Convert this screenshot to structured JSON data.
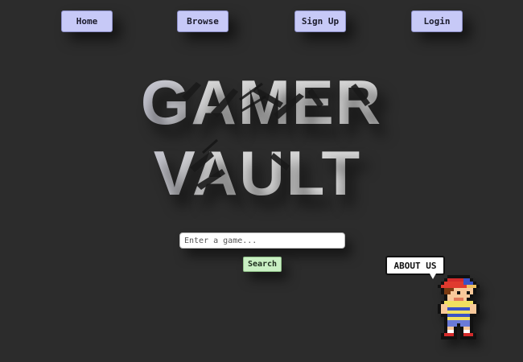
{
  "nav": {
    "home": "Home",
    "browse": "Browse",
    "signup": "Sign Up",
    "login": "Login"
  },
  "title": {
    "line1": "GAMER",
    "line2": "VAULT"
  },
  "search": {
    "placeholder": "Enter a game...",
    "button": "Search"
  },
  "about": {
    "label": "ABOUT US",
    "icon": "pixel-character-icon"
  },
  "colors": {
    "background": "#2c2c2c",
    "nav_button": "#c7c9f7",
    "search_button": "#c9f0c3"
  }
}
